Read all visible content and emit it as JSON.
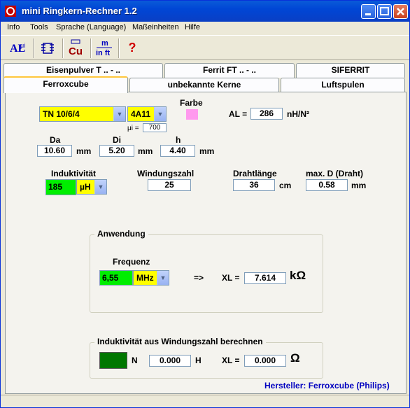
{
  "window": {
    "title": "mini Ringkern-Rechner 1.2"
  },
  "menu": [
    "Info",
    "Tools",
    "Sprache (Language)",
    "Maßeinheiten",
    "Hilfe"
  ],
  "toolbar": {
    "help_glyph": "?",
    "cu_label": "Cu",
    "m_label": "m",
    "inft_label": "in ft",
    "al_label": "AL",
    "mu_label": "μi"
  },
  "tabs_top": [
    "Eisenpulver T .. - ..",
    "Ferrit FT .. - ..",
    "SIFERRIT"
  ],
  "tabs_bottom": [
    "Ferroxcube",
    "unbekannte Kerne",
    "Luftspulen"
  ],
  "core": {
    "type": "TN 10/6/4",
    "material": "4A11",
    "mu_label": "μi =",
    "mu_value": "700",
    "farbe_label": "Farbe",
    "farbe_color": "#ff99ee",
    "al_label": "AL =",
    "al_value": "286",
    "al_unit": "nH/N²"
  },
  "dims": {
    "da_label": "Da",
    "da_value": "10.60",
    "da_unit": "mm",
    "di_label": "Di",
    "di_value": "5.20",
    "di_unit": "mm",
    "h_label": "h",
    "h_value": "4.40",
    "h_unit": "mm"
  },
  "calc": {
    "ind_label": "Induktivität",
    "ind_value": "185",
    "ind_unit": "µH",
    "wind_label": "Windungszahl",
    "wind_value": "25",
    "draht_label": "Drahtlänge",
    "draht_value": "36",
    "draht_unit": "cm",
    "maxd_label": "max. D (Draht)",
    "maxd_value": "0.58",
    "maxd_unit": "mm"
  },
  "anwendung": {
    "title": "Anwendung",
    "freq_label": "Frequenz",
    "freq_value": "6,55",
    "freq_unit": "MHz",
    "arrow": "=>",
    "xl_label": "XL =",
    "xl_value": "7.614",
    "xl_unit": "kΩ"
  },
  "berechnen": {
    "title": "Induktivität aus Windungszahl berechnen",
    "n_label": "N",
    "h_value": "0.000",
    "h_unit": "H",
    "xl_label": "XL =",
    "xl_value": "0.000",
    "xl_unit": "Ω"
  },
  "manufacturer": "Hersteller: Ferroxcube (Philips)"
}
